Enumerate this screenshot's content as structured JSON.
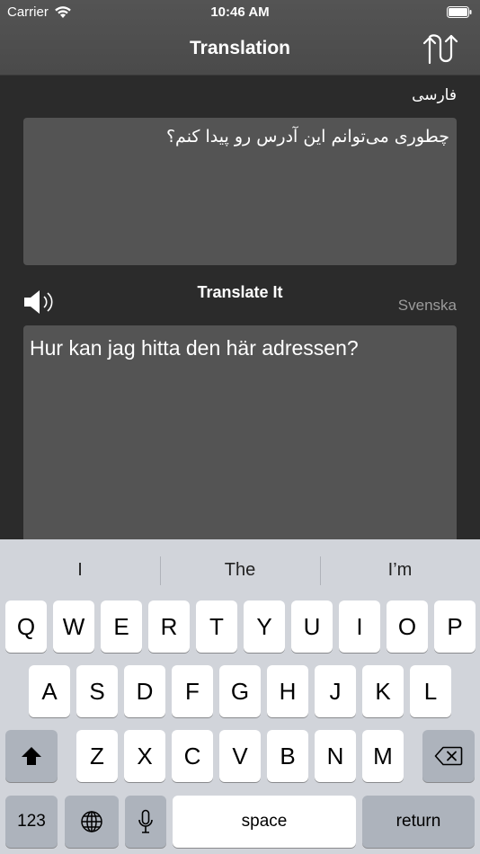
{
  "status_bar": {
    "carrier": "Carrier",
    "time": "10:46 AM",
    "icons": [
      "wifi-icon",
      "battery-icon"
    ]
  },
  "nav": {
    "title": "Translation",
    "swap_icon": "swap-languages-icon"
  },
  "source": {
    "language": "فارسی",
    "text": "چطوری می‌توانم این آدرس رو پیدا کنم؟"
  },
  "controls": {
    "speaker_icon": "speaker-icon",
    "translate_label": "Translate It"
  },
  "target": {
    "language": "Svenska",
    "text": "Hur kan jag hitta den här adressen?"
  },
  "keyboard": {
    "suggestions": [
      "I",
      "The",
      "I’m"
    ],
    "row1": [
      "Q",
      "W",
      "E",
      "R",
      "T",
      "Y",
      "U",
      "I",
      "O",
      "P"
    ],
    "row2": [
      "A",
      "S",
      "D",
      "F",
      "G",
      "H",
      "J",
      "K",
      "L"
    ],
    "row3": [
      "Z",
      "X",
      "C",
      "V",
      "B",
      "N",
      "M"
    ],
    "numbers_label": "123",
    "space_label": "space",
    "return_label": "return",
    "icons": [
      "shift-icon",
      "backspace-icon",
      "globe-icon",
      "microphone-icon"
    ],
    "colors": {
      "background": "#d1d4da",
      "key": "#ffffff",
      "dark_key": "#adb3bc"
    }
  }
}
